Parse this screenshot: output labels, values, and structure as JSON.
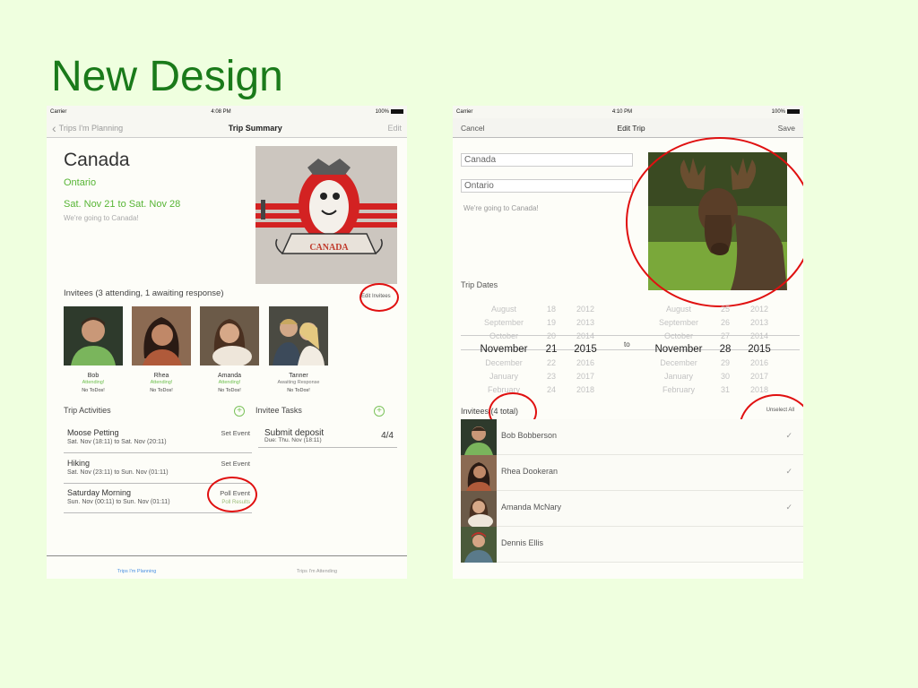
{
  "slide": {
    "title": "New Design"
  },
  "left": {
    "status": {
      "carrier": "Carrier",
      "time": "4:08 PM",
      "battery": "100%"
    },
    "nav": {
      "back": "Trips I'm Planning",
      "title": "Trip Summary",
      "edit": "Edit"
    },
    "trip": {
      "name": "Canada",
      "region": "Ontario",
      "dates": "Sat. Nov 21 to Sat. Nov 28",
      "description": "We're going to Canada!",
      "crest_text": "CANADA"
    },
    "invitees": {
      "title": "Invitees (3 attending, 1 awaiting response)",
      "edit_label": "Edit Invitees",
      "people": [
        {
          "name": "Bob",
          "status": "Attending!",
          "todo": "No ToDos!"
        },
        {
          "name": "Rhea",
          "status": "Attending!",
          "todo": "No ToDos!"
        },
        {
          "name": "Amanda",
          "status": "Attending!",
          "todo": "No ToDos!"
        },
        {
          "name": "Tanner",
          "status": "Awaiting Response",
          "todo": "No ToDos!"
        }
      ]
    },
    "activities": {
      "title": "Trip Activities",
      "items": [
        {
          "name": "Moose Petting",
          "time": "Sat. Nov (18:11) to Sat. Nov (20:11)",
          "action": "Set Event",
          "sub": ""
        },
        {
          "name": "Hiking",
          "time": "Sat. Nov (23:11) to Sun. Nov (01:11)",
          "action": "Set Event",
          "sub": ""
        },
        {
          "name": "Saturday Morning",
          "time": "Sun. Nov (00:11) to Sun. Nov (01:11)",
          "action": "Poll Event",
          "sub": "Poll Results"
        }
      ]
    },
    "tasks": {
      "title": "Invitee Tasks",
      "items": [
        {
          "name": "Submit deposit",
          "due": "Due: Thu. Nov (18:11)",
          "count": "4/4"
        }
      ]
    },
    "tabs": [
      {
        "label": "Trips I'm Planning",
        "active": true
      },
      {
        "label": "Trips I'm Attending",
        "active": false
      }
    ]
  },
  "right": {
    "status": {
      "carrier": "Carrier",
      "time": "4:10 PM",
      "battery": "100%"
    },
    "nav": {
      "cancel": "Cancel",
      "title": "Edit Trip",
      "save": "Save"
    },
    "form": {
      "name": "Canada",
      "region": "Ontario",
      "description": "We're going to Canada!"
    },
    "dates_label": "Trip Dates",
    "picker": {
      "to_label": "to",
      "start": {
        "months": [
          "August",
          "September",
          "October",
          "November",
          "December",
          "January",
          "February"
        ],
        "days": [
          "18",
          "19",
          "20",
          "21",
          "22",
          "23",
          "24"
        ],
        "years": [
          "2012",
          "2013",
          "2014",
          "2015",
          "2016",
          "2017",
          "2018"
        ]
      },
      "end": {
        "months": [
          "August",
          "September",
          "October",
          "November",
          "December",
          "January",
          "February"
        ],
        "days": [
          "25",
          "26",
          "27",
          "28",
          "29",
          "30",
          "31"
        ],
        "years": [
          "2012",
          "2013",
          "2014",
          "2015",
          "2016",
          "2017",
          "2018"
        ]
      }
    },
    "invitees": {
      "title": "Invitees (4 total)",
      "unselect": "Unselect All",
      "people": [
        {
          "name": "Bob Bobberson",
          "checked": true
        },
        {
          "name": "Rhea Dookeran",
          "checked": true
        },
        {
          "name": "Amanda McNary",
          "checked": true
        },
        {
          "name": "Dennis Ellis",
          "checked": false
        }
      ],
      "check_glyph": "✓"
    }
  },
  "colors": {
    "title_green": "#1a7a1a",
    "accent_green": "#57b535",
    "highlight_red": "#e01010",
    "background": "#efffdf"
  }
}
